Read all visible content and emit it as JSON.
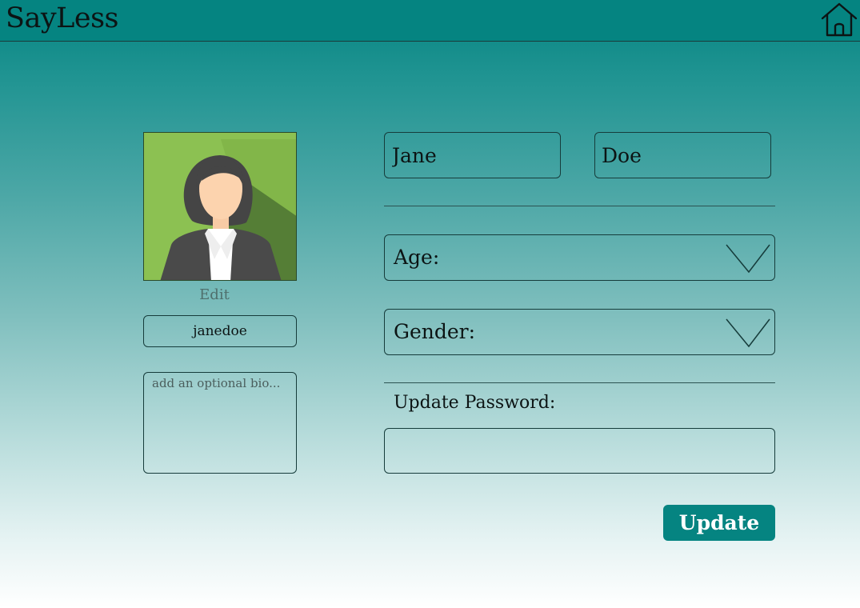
{
  "app": {
    "title": "SayLess"
  },
  "header": {
    "home_icon": "home-icon"
  },
  "profile": {
    "edit_label": "Edit",
    "username": "janedoe",
    "bio_placeholder": "add an optional bio..."
  },
  "form": {
    "first_name": "Jane",
    "last_name": "Doe",
    "age_label": "Age:",
    "gender_label": "Gender:",
    "password_label": "Update Password:",
    "password_value": "",
    "update_label": "Update"
  },
  "colors": {
    "accent": "#058481",
    "text": "#0c1414",
    "avatar_bg": "#8cc152"
  }
}
